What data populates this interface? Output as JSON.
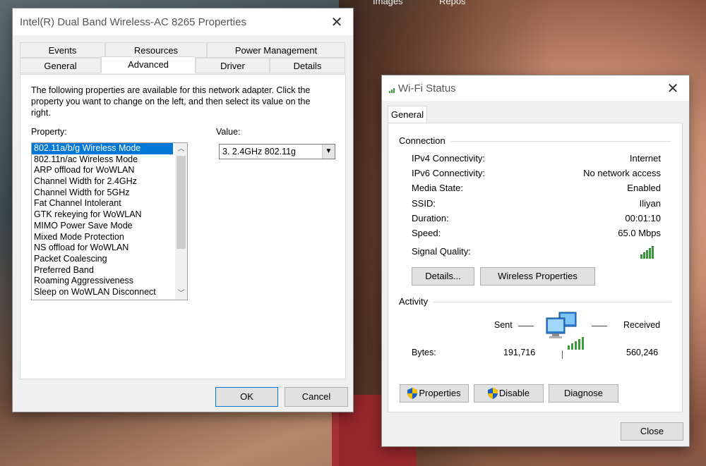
{
  "desktop": {
    "text_left": "Images",
    "text_right": "Repos"
  },
  "props_dialog": {
    "title": "Intel(R) Dual Band Wireless-AC 8265 Properties",
    "tabs_row1": [
      "Events",
      "Resources",
      "Power Management"
    ],
    "tabs_row2": [
      "General",
      "Advanced",
      "Driver",
      "Details"
    ],
    "active_tab": "Advanced",
    "description": "The following properties are available for this network adapter. Click the property you want to change on the left, and then select its value on the right.",
    "property_label": "Property:",
    "value_label": "Value:",
    "properties": [
      "802.11a/b/g Wireless Mode",
      "802.11n/ac Wireless Mode",
      "ARP offload for WoWLAN",
      "Channel Width for 2.4GHz",
      "Channel Width for 5GHz",
      "Fat Channel Intolerant",
      "GTK rekeying for WoWLAN",
      "MIMO Power Save Mode",
      "Mixed Mode Protection",
      "NS offload for WoWLAN",
      "Packet Coalescing",
      "Preferred Band",
      "Roaming Aggressiveness",
      "Sleep on WoWLAN Disconnect"
    ],
    "selected_property": "802.11a/b/g Wireless Mode",
    "selected_value": "3. 2.4GHz 802.11g",
    "ok_label": "OK",
    "cancel_label": "Cancel"
  },
  "wifi_status": {
    "title": "Wi-Fi Status",
    "tab": "General",
    "connection_title": "Connection",
    "connection": [
      {
        "label": "IPv4 Connectivity:",
        "value": "Internet"
      },
      {
        "label": "IPv6 Connectivity:",
        "value": "No network access"
      },
      {
        "label": "Media State:",
        "value": "Enabled"
      },
      {
        "label": "SSID:",
        "value": "Iliyan"
      },
      {
        "label": "Duration:",
        "value": "00:01:10"
      },
      {
        "label": "Speed:",
        "value": "65.0 Mbps"
      }
    ],
    "signal_label": "Signal Quality:",
    "signal_bars": 5,
    "details_label": "Details...",
    "wireless_props_label": "Wireless Properties",
    "activity_title": "Activity",
    "sent_label": "Sent",
    "received_label": "Received",
    "bytes_label": "Bytes:",
    "bytes_sent": "191,716",
    "bytes_received": "560,246",
    "properties_label": "Properties",
    "disable_label": "Disable",
    "diagnose_label": "Diagnose",
    "close_label": "Close"
  },
  "colors": {
    "selection": "#0078d7",
    "signal_green": "#3a9a3a"
  }
}
